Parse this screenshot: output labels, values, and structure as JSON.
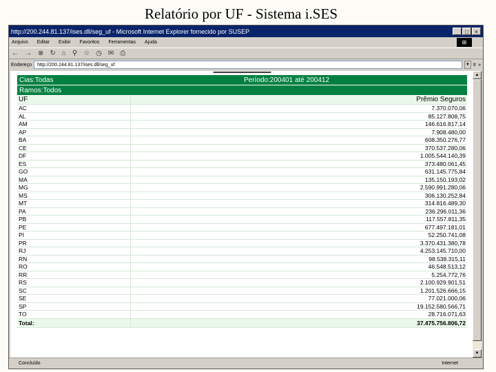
{
  "slide": {
    "title": "Relatório por UF - Sistema i.SES"
  },
  "window": {
    "title": "http://200.244.81.137/ises.dll/seg_uf - Microsoft Internet Explorer fornecido por SUSEP",
    "min_glyph": "_",
    "max_glyph": "□",
    "close_glyph": "×",
    "brand": "⊞"
  },
  "menu": [
    "Arquivo",
    "Editar",
    "Exibir",
    "Favoritos",
    "Ferramentas",
    "Ajuda"
  ],
  "toolbar": {
    "back_glyph": "←",
    "forward_glyph": "→",
    "stop_glyph": "⊗",
    "refresh_glyph": "↻",
    "home_glyph": "⌂",
    "search_glyph": "⚲",
    "favorites_glyph": "☆",
    "history_glyph": "◷",
    "mail_glyph": "✉",
    "print_glyph": "⎙"
  },
  "address": {
    "label": "Endereço",
    "url": "http://200.244.81.137/ises.dll/seg_uf",
    "go_label": "Ir",
    "links_label": "»"
  },
  "report": {
    "cias_label": "Cias:Todas",
    "periodo_label": "Período:200401 até 200412",
    "ramos_label": "Ramos:Todos",
    "columns": [
      "UF",
      "Prêmio Seguros"
    ],
    "rows": [
      [
        "AC",
        "7.370.070,06"
      ],
      [
        "AL",
        "85.127.808,75"
      ],
      [
        "AM",
        "146.616.817,14"
      ],
      [
        "AP",
        "7.908.480,00"
      ],
      [
        "BA",
        "608.350.276,77"
      ],
      [
        "CE",
        "370.537.280,06"
      ],
      [
        "DF",
        "1.005.544.140,39"
      ],
      [
        "ES",
        "373.480.061,45"
      ],
      [
        "GO",
        "631.145.775,84"
      ],
      [
        "MA",
        "135.150.193,02"
      ],
      [
        "MG",
        "2.590.991.280,06"
      ],
      [
        "MS",
        "306.130.252,84"
      ],
      [
        "MT",
        "314.816.489,30"
      ],
      [
        "PA",
        "236.296.011,36"
      ],
      [
        "PB",
        "117.557.811,35"
      ],
      [
        "PE",
        "677.497.181,01"
      ],
      [
        "PI",
        "52.250.741,08"
      ],
      [
        "PR",
        "3.370.431.380,78"
      ],
      [
        "RJ",
        "4.253.145.710,00"
      ],
      [
        "RN",
        "98.538.315,11"
      ],
      [
        "RO",
        "46.548.513,12"
      ],
      [
        "RR",
        "5.254.772,76"
      ],
      [
        "RS",
        "2.100.929.901,51"
      ],
      [
        "SC",
        "1.201.526.666,15"
      ],
      [
        "SE",
        "77.021.000,06"
      ],
      [
        "SP",
        "19.152.580.566,71"
      ],
      [
        "TO",
        "28.716.071,63"
      ]
    ],
    "total_label": "Total:",
    "total_value": "37.475.756.806,72"
  },
  "status": {
    "text": "Concluído",
    "zone": "Internet"
  },
  "colors": {
    "header_green": "#008040",
    "titlebar_blue": "#0a246a"
  }
}
